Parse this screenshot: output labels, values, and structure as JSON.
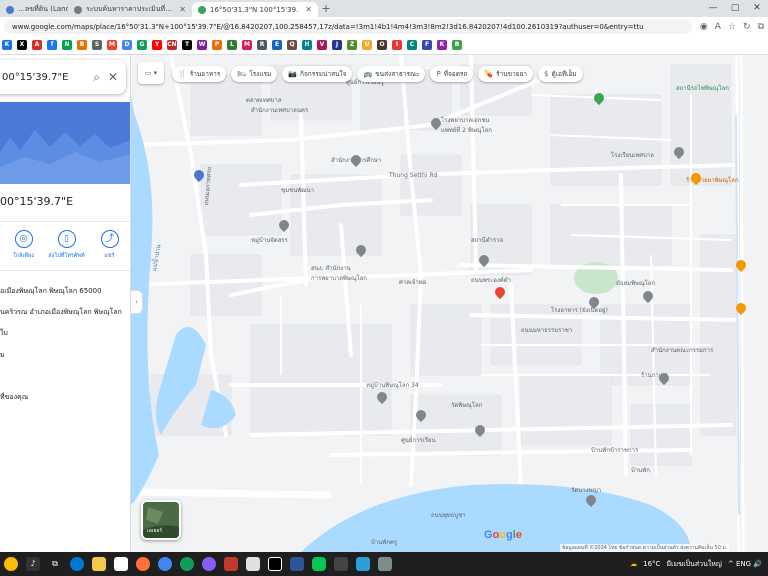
{
  "browser": {
    "tabs": [
      {
        "title": "…ลขที่ดิน (LandsMaps",
        "active": false,
        "favicon_color": "#4a7dbe"
      },
      {
        "title": "ระบบค้นหาราคาประเมินที่ดินโดยพิจารณาจากเลขโฉนด",
        "active": false,
        "favicon_color": "#7a7a7a"
      },
      {
        "title": "16°50'31.3\"N 100°15'39.7\"E - Go",
        "active": true,
        "favicon_color": "#34a853"
      }
    ],
    "new_tab": "+",
    "url": "www.google.com/maps/place/16°50'31.3\"N+100°15'39.7\"E/@16.8420207,100.258457,17z/data=!3m1!4b1!4m4!3m3!8m2!3d16.8420207!4d100.2610319?authuser=0&entry=ttu",
    "minimize": "—",
    "maximize": "▢",
    "close": "✕"
  },
  "bookmarks": [
    {
      "label": "K",
      "color": "#1a73e8"
    },
    {
      "label": "X",
      "color": "#000000"
    },
    {
      "label": "A",
      "color": "#d93025"
    },
    {
      "label": "f",
      "color": "#1877f2"
    },
    {
      "label": "N",
      "color": "#00a651"
    },
    {
      "label": "B",
      "color": "#e37400"
    },
    {
      "label": "S",
      "color": "#5f6368"
    },
    {
      "label": "M",
      "color": "#ea4335"
    },
    {
      "label": "D",
      "color": "#4285f4"
    },
    {
      "label": "G",
      "color": "#0f9d58"
    },
    {
      "label": "Y",
      "color": "#ff0000"
    },
    {
      "label": "CN",
      "color": "#c62828"
    },
    {
      "label": "T",
      "color": "#000000"
    },
    {
      "label": "W",
      "color": "#7b1fa2"
    },
    {
      "label": "P",
      "color": "#ef6c00"
    },
    {
      "label": "L",
      "color": "#2e7d32"
    },
    {
      "label": "M",
      "color": "#d81b60"
    },
    {
      "label": "R",
      "color": "#455a64"
    },
    {
      "label": "E",
      "color": "#1565c0"
    },
    {
      "label": "Q",
      "color": "#6d4c41"
    },
    {
      "label": "H",
      "color": "#00838f"
    },
    {
      "label": "V",
      "color": "#ad1457"
    },
    {
      "label": "J",
      "color": "#283593"
    },
    {
      "label": "Z",
      "color": "#558b2f"
    },
    {
      "label": "U",
      "color": "#f9a825"
    },
    {
      "label": "O",
      "color": "#4e342e"
    },
    {
      "label": "I",
      "color": "#e53935"
    },
    {
      "label": "C",
      "color": "#00897b"
    },
    {
      "label": "F",
      "color": "#3949ab"
    },
    {
      "label": "K",
      "color": "#8e24aa"
    },
    {
      "label": "B",
      "color": "#43a047"
    }
  ],
  "panel": {
    "search_value": "00°15'39.7\"E",
    "place_title": "00°15'39.7\"E",
    "actions": [
      {
        "icon": "◎",
        "label": "ใกล้เคียง"
      },
      {
        "icon": "▯",
        "label": "ส่งไปที่โทรศัพท์"
      },
      {
        "icon": "⤴",
        "label": "แชร์"
      }
    ],
    "info": [
      "อเมืองพิษณุโลก พิษณุโลก 65000",
      "นคริวรณ อำเภอเมืองพิษณุโลก พิษณุโลก",
      "ใบ",
      "ม",
      "ที่ของคุณ"
    ]
  },
  "map": {
    "layers_label": "▭ ▾",
    "chips": [
      {
        "icon": "🍴",
        "label": "ร้านอาหาร"
      },
      {
        "icon": "🛏",
        "label": "โรงแรม"
      },
      {
        "icon": "📷",
        "label": "กิจกรรมน่าสนใจ"
      },
      {
        "icon": "🚌",
        "label": "ขนส่งสาธารณะ"
      },
      {
        "icon": "P",
        "label": "ที่จอดรถ"
      },
      {
        "icon": "💊",
        "label": "ร้านขายยา"
      },
      {
        "icon": "$",
        "label": "ตู้เอทีเอ็ม"
      }
    ],
    "labels": [
      {
        "text": "ตลาดเทศบาล",
        "style": "poi"
      },
      {
        "text": "สำนักงานเทศบาลนคร",
        "style": "poi"
      },
      {
        "text": "ศูนย์การเรียนรู้",
        "style": "poi"
      },
      {
        "text": "โรงพยาบาลเอกชน",
        "style": "poi"
      },
      {
        "text": "แพทย์ที่ 2 พิษณุโลก",
        "style": "poi"
      },
      {
        "text": "Thung Setthi Rd",
        "style": "road"
      },
      {
        "text": "สำนักงานการศึกษา",
        "style": "poi"
      },
      {
        "text": "ชุมชนพัฒนา",
        "style": "poi"
      },
      {
        "text": "หมู่บ้านจัดสรร",
        "style": "poi"
      },
      {
        "text": "ถนนเอกาทศรถ",
        "style": "road"
      },
      {
        "text": "สนง. สำนักงาน",
        "style": "poi"
      },
      {
        "text": "การพยาบาลพิษณุโลก",
        "style": "poi"
      },
      {
        "text": "ศาลเจ้าพ่อ",
        "style": "poi"
      },
      {
        "text": "สถานีตำรวจ",
        "style": "poi"
      },
      {
        "text": "ถนนพระองค์ดำ",
        "style": "road"
      },
      {
        "text": "โรงอาหาร (ยังเปิดอยู่)",
        "style": "poi"
      },
      {
        "text": "มัธยมพิษณุโลก",
        "style": "poi"
      },
      {
        "text": "สำนักงานคณะกรรมการ",
        "style": "poi"
      },
      {
        "text": "ร้านกาแฟ",
        "style": "poi"
      },
      {
        "text": "หมู่บ้านพิษณุโลก 34",
        "style": "poi"
      },
      {
        "text": "วัดพิษณุโลก",
        "style": "poi"
      },
      {
        "text": "ศูนย์การเรียน",
        "style": "poi"
      },
      {
        "text": "บ้านพักข้าราชการ",
        "style": "poi"
      },
      {
        "text": "สถานีรถไฟพิษณุโลก",
        "style": "green"
      },
      {
        "text": "ร้านขายยาพิษณุโลก",
        "style": "orange"
      },
      {
        "text": "โรงเรียนเทศบาล",
        "style": "poi"
      },
      {
        "text": "บ้านพัก",
        "style": "poi"
      },
      {
        "text": "วัดนางพญา",
        "style": "poi"
      },
      {
        "text": "แม่น้ำน่าน",
        "style": "blue"
      },
      {
        "text": "ถนนมหาธรรมราชา",
        "style": "road"
      },
      {
        "text": "บ้านพักครู",
        "style": "poi"
      },
      {
        "text": "ถนนพุทธบูชา",
        "style": "road"
      }
    ],
    "satellite_label": "เลเยอร์",
    "google": [
      "G",
      "o",
      "o",
      "g",
      "l",
      "e"
    ],
    "google_colors": [
      "#4285f4",
      "#ea4335",
      "#fbbc05",
      "#4285f4",
      "#34a853",
      "#ea4335"
    ],
    "attribution": "ข้อมูลแผนที่ ©2024   ไทย   ข้อกำหนด   ความเป็นส่วนตัว   ส่งความคิดเห็น   50 ม."
  },
  "taskbar": {
    "weather": "16°C",
    "weather_desc": "มีเมฆเป็นส่วนใหญ่",
    "tray": "^  ENG  🔊"
  },
  "colors": {
    "water": "#aadaff",
    "road": "#ffffff",
    "block": "#e8eaed",
    "park": "#c8e6c9",
    "marker": "#ea4335"
  }
}
